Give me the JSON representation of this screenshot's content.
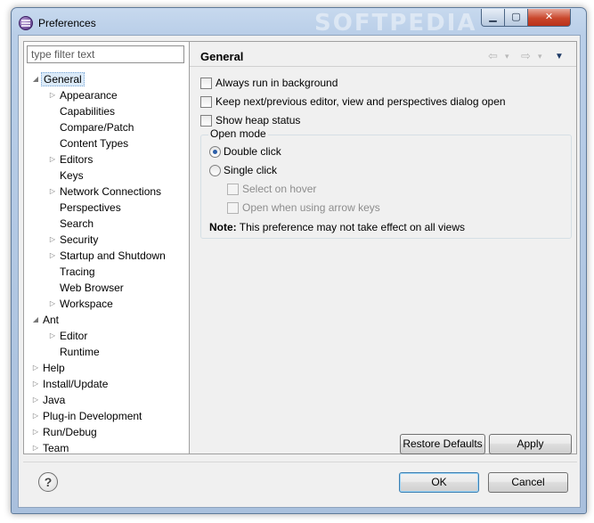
{
  "window": {
    "title": "Preferences",
    "watermark": "SOFTPEDIA",
    "controls": {
      "minimize": "▁",
      "maximize": "▢",
      "close": "✕"
    }
  },
  "filter": {
    "placeholder": "type filter text"
  },
  "tree": [
    {
      "label": "General",
      "depth": 0,
      "expander": "expanded",
      "selected": true
    },
    {
      "label": "Appearance",
      "depth": 1,
      "expander": "collapsed"
    },
    {
      "label": "Capabilities",
      "depth": 1,
      "expander": "none"
    },
    {
      "label": "Compare/Patch",
      "depth": 1,
      "expander": "none"
    },
    {
      "label": "Content Types",
      "depth": 1,
      "expander": "none"
    },
    {
      "label": "Editors",
      "depth": 1,
      "expander": "collapsed"
    },
    {
      "label": "Keys",
      "depth": 1,
      "expander": "none"
    },
    {
      "label": "Network Connections",
      "depth": 1,
      "expander": "collapsed"
    },
    {
      "label": "Perspectives",
      "depth": 1,
      "expander": "none"
    },
    {
      "label": "Search",
      "depth": 1,
      "expander": "none"
    },
    {
      "label": "Security",
      "depth": 1,
      "expander": "collapsed"
    },
    {
      "label": "Startup and Shutdown",
      "depth": 1,
      "expander": "collapsed"
    },
    {
      "label": "Tracing",
      "depth": 1,
      "expander": "none"
    },
    {
      "label": "Web Browser",
      "depth": 1,
      "expander": "none"
    },
    {
      "label": "Workspace",
      "depth": 1,
      "expander": "collapsed"
    },
    {
      "label": "Ant",
      "depth": 0,
      "expander": "expanded"
    },
    {
      "label": "Editor",
      "depth": 1,
      "expander": "collapsed"
    },
    {
      "label": "Runtime",
      "depth": 1,
      "expander": "none"
    },
    {
      "label": "Help",
      "depth": 0,
      "expander": "collapsed"
    },
    {
      "label": "Install/Update",
      "depth": 0,
      "expander": "collapsed"
    },
    {
      "label": "Java",
      "depth": 0,
      "expander": "collapsed"
    },
    {
      "label": "Plug-in Development",
      "depth": 0,
      "expander": "collapsed"
    },
    {
      "label": "Run/Debug",
      "depth": 0,
      "expander": "collapsed"
    },
    {
      "label": "Team",
      "depth": 0,
      "expander": "collapsed"
    }
  ],
  "page": {
    "title": "General",
    "nav": {
      "back": "⇦",
      "forward": "⇨",
      "dropdown": "▾",
      "menu": "▼"
    },
    "checkboxes": [
      {
        "label": "Always run in background",
        "checked": false
      },
      {
        "label": "Keep next/previous editor, view and perspectives dialog open",
        "checked": false
      },
      {
        "label": "Show heap status",
        "checked": false
      }
    ],
    "open_mode": {
      "label": "Open mode",
      "double_click": "Double click",
      "single_click": "Single click",
      "selected": "double_click",
      "select_on_hover": "Select on hover",
      "open_with_arrow_keys": "Open when using arrow keys",
      "note_prefix": "Note:",
      "note_text": " This preference may not take effect on all views"
    },
    "restore_defaults": "Restore Defaults",
    "apply": "Apply"
  },
  "footer": {
    "help": "?",
    "ok": "OK",
    "cancel": "Cancel"
  }
}
